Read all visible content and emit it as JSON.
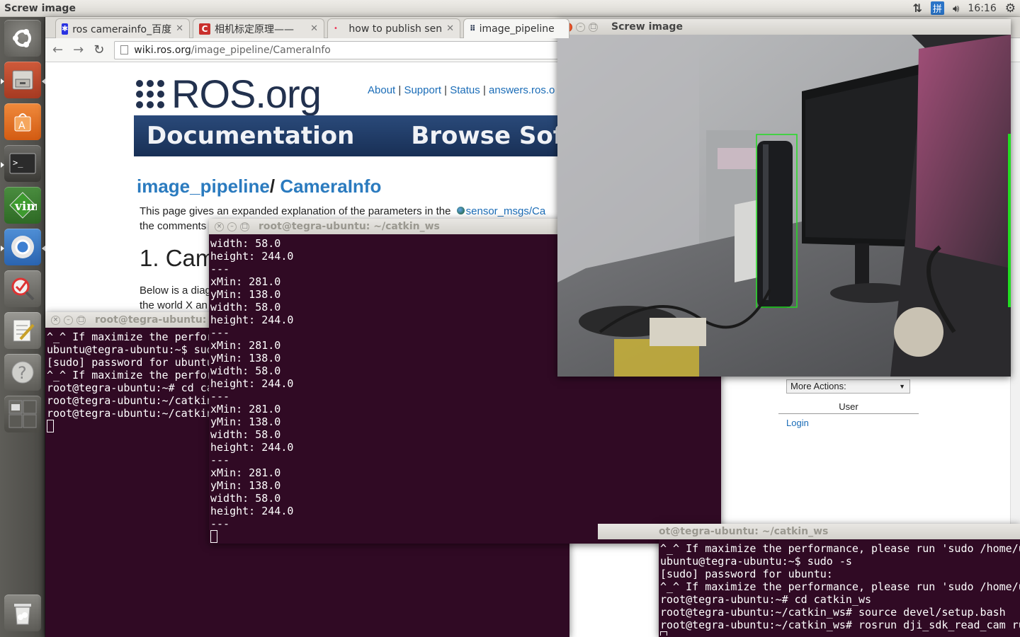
{
  "topbar": {
    "title": "Screw image",
    "clock": "16:16",
    "input_method": "拼",
    "network_icon": "network-updown-icon",
    "volume_icon": "speaker-volume-icon",
    "power_icon": "power-gear-icon"
  },
  "launcher": {
    "items": [
      "dash-home",
      "files",
      "software-center",
      "terminal",
      "vim",
      "chromium",
      "qtcreator",
      "text-editor",
      "help",
      "workspace-switcher",
      "trash"
    ],
    "vim_label": "vim"
  },
  "browser": {
    "tabs": [
      {
        "label": "ros camerainfo_百度",
        "icon": "baidu-paw-icon"
      },
      {
        "label": "相机标定原理——",
        "icon": "csdn-c-icon"
      },
      {
        "label": "how to publish sen",
        "icon": "loading-dot-icon"
      },
      {
        "label": "image_pipeline",
        "icon": "ros-dots-icon"
      }
    ],
    "url_host": "wiki.ros.org",
    "url_path": "/image_pipeline/CameraInfo",
    "site": {
      "logo_text": "ROS.org",
      "nav_links": [
        "About",
        "Support",
        "Status",
        "answers.ros.o"
      ],
      "nav_sep": "|",
      "banner_items": [
        "Documentation",
        "Browse Softwa"
      ]
    },
    "heading": {
      "part1": "image_pipeline",
      "sep": "/",
      "part2": "CameraInfo"
    },
    "intro_line1": "This page gives an expanded explanation of the parameters in the",
    "intro_link": "sensor_msgs/Ca",
    "intro_line2": "the comments",
    "section_title": "1. Cam",
    "body_line1": "Below is a diag",
    "body_line2": "the world X an",
    "sidebar": {
      "more_actions": "More Actions:",
      "user_heading": "User",
      "login": "Login"
    }
  },
  "screw_window": {
    "title": "Screw image",
    "detection_box_color": "#22dd22"
  },
  "term_left": {
    "title": "root@tegra-ubuntu: ~/catkin_ws",
    "lines": [
      "^_^ If maximize the perfor",
      "ubuntu@tegra-ubuntu:~$ sud",
      "[sudo] password for ubuntu",
      "^_^ If maximize the perfor",
      "root@tegra-ubuntu:~# cd ca",
      "root@tegra-ubuntu:~/catkin",
      "root@tegra-ubuntu:~/catkin"
    ]
  },
  "term_mid": {
    "title": "root@tegra-ubuntu: ~/catkin_ws",
    "lines": [
      "width: 58.0",
      "height: 244.0",
      "---",
      "xMin: 281.0",
      "yMin: 138.0",
      "width: 58.0",
      "height: 244.0",
      "---",
      "xMin: 281.0",
      "yMin: 138.0",
      "width: 58.0",
      "height: 244.0",
      "---",
      "xMin: 281.0",
      "yMin: 138.0",
      "width: 58.0",
      "height: 244.0",
      "---",
      "xMin: 281.0",
      "yMin: 138.0",
      "width: 58.0",
      "height: 244.0",
      "---"
    ]
  },
  "term_right": {
    "title": "ot@tegra-ubuntu: ~/catkin_ws",
    "lines": [
      "^_^ If maximize the performance, please run 'sudo /home/u",
      "ubuntu@tegra-ubuntu:~$ sudo -s",
      "[sudo] password for ubuntu:",
      "^_^ If maximize the performance, please run 'sudo /home/u",
      "root@tegra-ubuntu:~# cd catkin_ws",
      "root@tegra-ubuntu:~/catkin_ws# source devel/setup.bash",
      "root@tegra-ubuntu:~/catkin_ws# rosrun dji_sdk_read_cam ru"
    ]
  },
  "colors": {
    "terminal_bg": "#300a24",
    "ros_blue": "#1a6cb7",
    "banner_bg": "#1f3d68",
    "ubuntu_orange": "#dd4814"
  }
}
